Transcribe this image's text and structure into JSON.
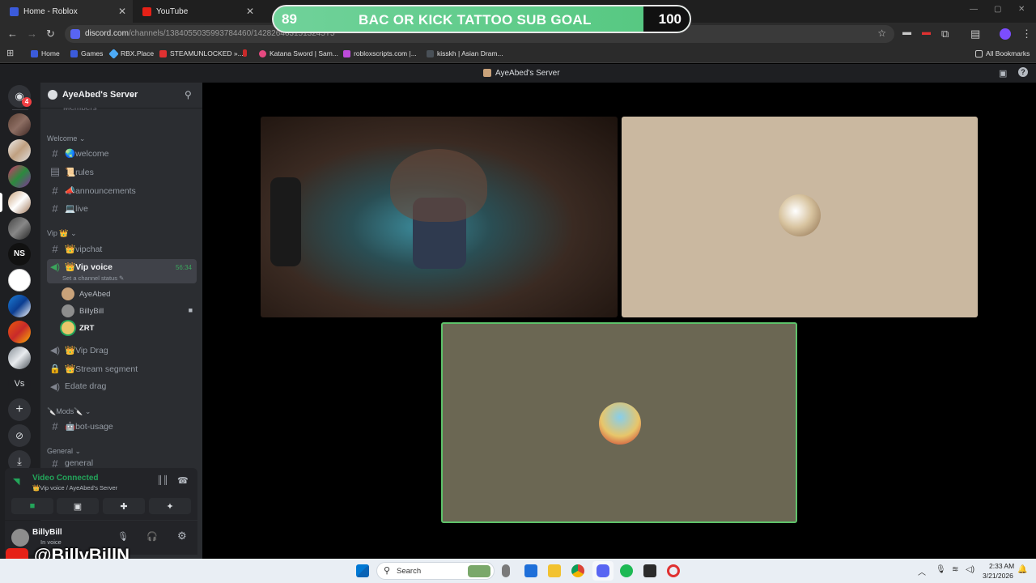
{
  "browser": {
    "tabs": [
      {
        "title": "Home - Roblox",
        "color": "#3b5bdb"
      },
      {
        "title": "YouTube",
        "color": "#e62117"
      }
    ],
    "url_host": "discord.com",
    "url_path": "/channels/1384055035993784460/1428264631513245T5",
    "bookmarks": [
      "Home",
      "Games",
      "RBX.Place",
      "STEAMUNLOCKED »...",
      "Katana Sword | Sam...",
      "robloxscripts.com |...",
      "kisskh | Asian Dram..."
    ],
    "all_bookmarks": "All Bookmarks"
  },
  "overlay": {
    "left_value": "89",
    "goal_title": "BAC OR KICK TATTOO SUB GOAL",
    "right_value": "100",
    "progress": 0.89,
    "watermark": "@BillyBillN"
  },
  "discord": {
    "window_title": "AyeAbed's Server",
    "notification_count": "4",
    "server_name": "AyeAbed's Server",
    "partial_top": "Members",
    "categories": {
      "welcome": "Welcome",
      "vip": "Vip 👑",
      "mods": "🔪Mods🔪",
      "general": "General"
    },
    "channels": {
      "welcome": "🌏welcome",
      "rules": "📜rules",
      "announcements": "📣announcements",
      "live": "💻live",
      "vipchat": "👑vipchat",
      "vip_voice": "👑Vip voice",
      "vip_voice_timer": "56:34",
      "vip_voice_status": "Set a channel status",
      "vip_drag": "👑Vip Drag",
      "stream_segment": "👑Stream segment",
      "edate_drag": "Edate drag",
      "bot_usage": "🤖bot-usage",
      "general_partial": "general"
    },
    "voice_users": [
      "AyeAbed",
      "BillyBill",
      "ZRT"
    ],
    "voice_panel": {
      "status": "Video Connected",
      "location": "👑Vip voice / AyeAbed's Server"
    },
    "user": {
      "name": "BillyBill",
      "status": "In voice"
    }
  },
  "taskbar": {
    "search_placeholder": "Search",
    "time": "2:33 AM",
    "date": "3/21/2026"
  }
}
